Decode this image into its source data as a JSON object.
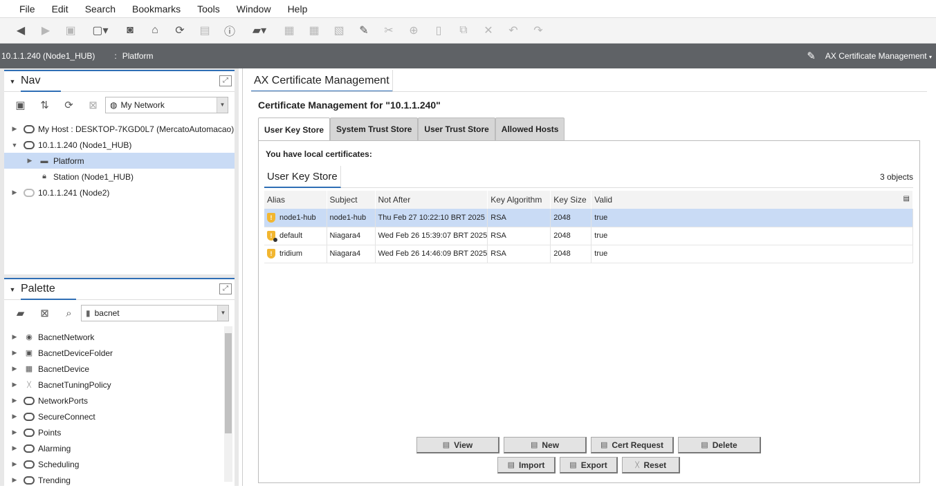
{
  "menubar": {
    "items": [
      "File",
      "Edit",
      "Search",
      "Bookmarks",
      "Tools",
      "Window",
      "Help"
    ]
  },
  "pathbar": {
    "host": "10.1.1.240 (Node1_HUB)",
    "separator": ":",
    "crumb": "Platform",
    "view": "AX Certificate Management"
  },
  "nav": {
    "title": "Nav",
    "network_combo": "My Network",
    "tree": [
      {
        "label": "My Host : DESKTOP-7KGD0L7 (MercatoAutomacao)"
      },
      {
        "label": "10.1.1.240 (Node1_HUB)"
      },
      {
        "label": "Platform"
      },
      {
        "label": "Station (Node1_HUB)"
      },
      {
        "label": "10.1.1.241 (Node2)"
      }
    ]
  },
  "palette": {
    "title": "Palette",
    "combo": "bacnet",
    "items": [
      {
        "label": "BacnetNetwork"
      },
      {
        "label": "BacnetDeviceFolder"
      },
      {
        "label": "BacnetDevice"
      },
      {
        "label": "BacnetTuningPolicy"
      },
      {
        "label": "NetworkPorts"
      },
      {
        "label": "SecureConnect"
      },
      {
        "label": "Points"
      },
      {
        "label": "Alarming"
      },
      {
        "label": "Scheduling"
      },
      {
        "label": "Trending"
      }
    ]
  },
  "main": {
    "tab": "AX Certificate Management",
    "heading": "Certificate Management for \"10.1.1.240\"",
    "tabs": [
      "User Key Store",
      "System Trust Store",
      "User Trust Store",
      "Allowed Hosts"
    ],
    "local_msg": "You have local certificates:",
    "store_title": "User Key Store",
    "count": "3 objects",
    "columns": [
      "Alias",
      "Subject",
      "Not After",
      "Key Algorithm",
      "Key Size",
      "Valid"
    ],
    "rows": [
      {
        "alias": "node1-hub",
        "subject": "node1-hub",
        "not_after": "Thu Feb 27 10:22:10 BRT 2025",
        "alg": "RSA",
        "size": "2048",
        "valid": "true"
      },
      {
        "alias": "default",
        "subject": "Niagara4",
        "not_after": "Wed Feb 26 15:39:07 BRT 2025",
        "alg": "RSA",
        "size": "2048",
        "valid": "true"
      },
      {
        "alias": "tridium",
        "subject": "Niagara4",
        "not_after": "Wed Feb 26 14:46:09 BRT 2025",
        "alg": "RSA",
        "size": "2048",
        "valid": "true"
      }
    ],
    "buttons": {
      "view": "View",
      "new": "New",
      "cert_request": "Cert Request",
      "delete": "Delete",
      "import": "Import",
      "export": "Export",
      "reset": "Reset"
    }
  },
  "colors": {
    "accent": "#2e6eb5",
    "selection": "#c9dbf5",
    "pathbar": "#5f6266",
    "warning": "#f2b630"
  }
}
